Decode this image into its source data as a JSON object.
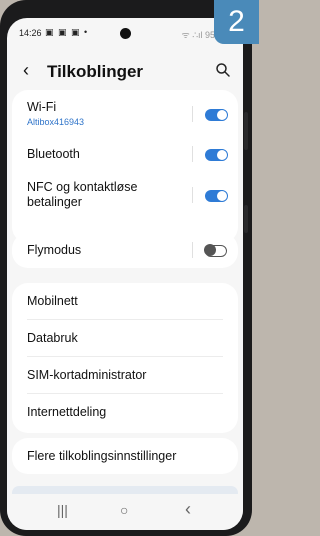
{
  "badge": "2",
  "statusbar": {
    "time": "14:26",
    "notifications": "▣ ▣ ▣ •",
    "right": "ᯤ ∴ıl 95%"
  },
  "appbar": {
    "back_icon": "chevron-left-icon",
    "title": "Tilkoblinger",
    "search_icon": "search-icon"
  },
  "sections": {
    "wifi": {
      "label": "Wi-Fi",
      "sub": "Altibox416943",
      "enabled": true
    },
    "bluetooth": {
      "label": "Bluetooth",
      "enabled": true
    },
    "nfc": {
      "label_line1": "NFC og kontaktløse",
      "label_line2": "betalinger",
      "enabled": true
    },
    "flymodus": {
      "label": "Flymodus",
      "enabled": false
    },
    "mobilnett": {
      "label": "Mobilnett"
    },
    "databruk": {
      "label": "Databruk"
    },
    "sim": {
      "label": "SIM-kortadministrator"
    },
    "internettdeling": {
      "label": "Internettdeling"
    },
    "flere": {
      "label": "Flere tilkoblingsinnstillinger"
    }
  },
  "navbar": {
    "recents": "|||",
    "home": "○",
    "back": "‹"
  },
  "colors": {
    "accent": "#2e7bd6",
    "badge": "#4a8ab9",
    "background": "#f6f6f6"
  }
}
